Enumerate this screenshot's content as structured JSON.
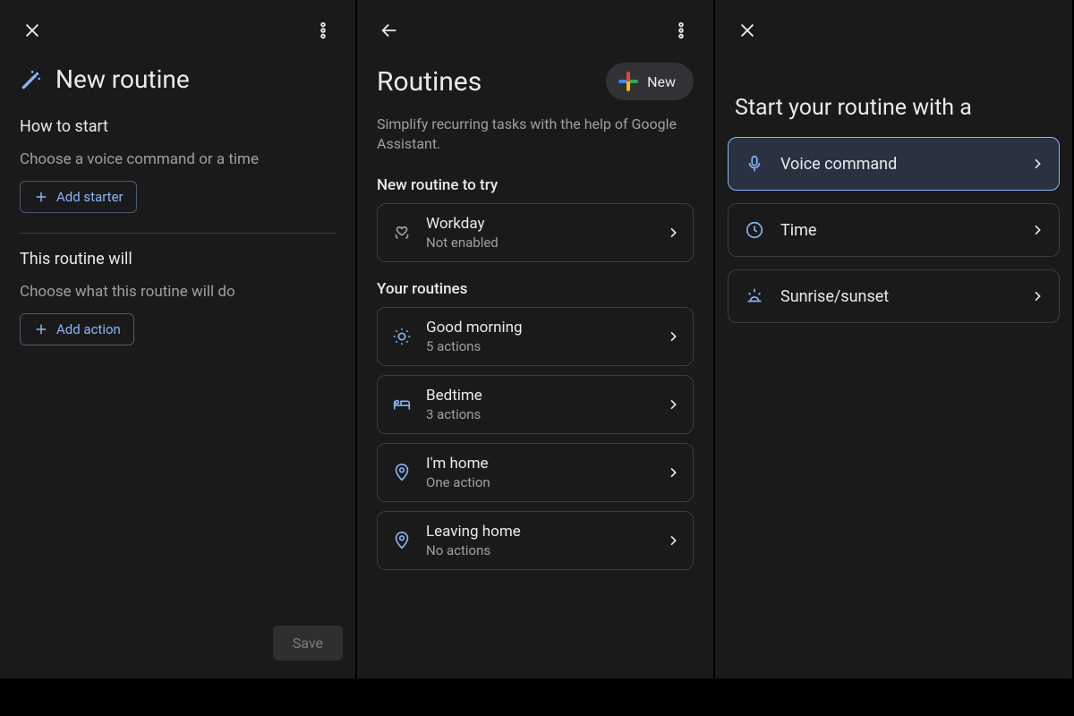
{
  "pane1": {
    "title": "New routine",
    "how_to_start": "How to start",
    "starter_hint": "Choose a voice command or a time",
    "add_starter": "Add starter",
    "this_will": "This routine will",
    "action_hint": "Choose what this routine will do",
    "add_action": "Add action",
    "save": "Save"
  },
  "pane2": {
    "title": "Routines",
    "new": "New",
    "subtitle": "Simplify recurring tasks with the help of Google Assistant.",
    "try_header": "New routine to try",
    "try_card": {
      "title": "Workday",
      "sub": "Not enabled",
      "icon": "heart-hands"
    },
    "your_header": "Your routines",
    "routines": [
      {
        "title": "Good morning",
        "sub": "5 actions",
        "icon": "sun"
      },
      {
        "title": "Bedtime",
        "sub": "3 actions",
        "icon": "bed"
      },
      {
        "title": "I'm home",
        "sub": "One action",
        "icon": "pin"
      },
      {
        "title": "Leaving home",
        "sub": "No actions",
        "icon": "pin"
      }
    ]
  },
  "pane3": {
    "title": "Start your routine with a",
    "options": [
      {
        "label": "Voice command",
        "icon": "mic",
        "selected": true
      },
      {
        "label": "Time",
        "icon": "clock",
        "selected": false
      },
      {
        "label": "Sunrise/sunset",
        "icon": "sunrise",
        "selected": false
      }
    ]
  }
}
